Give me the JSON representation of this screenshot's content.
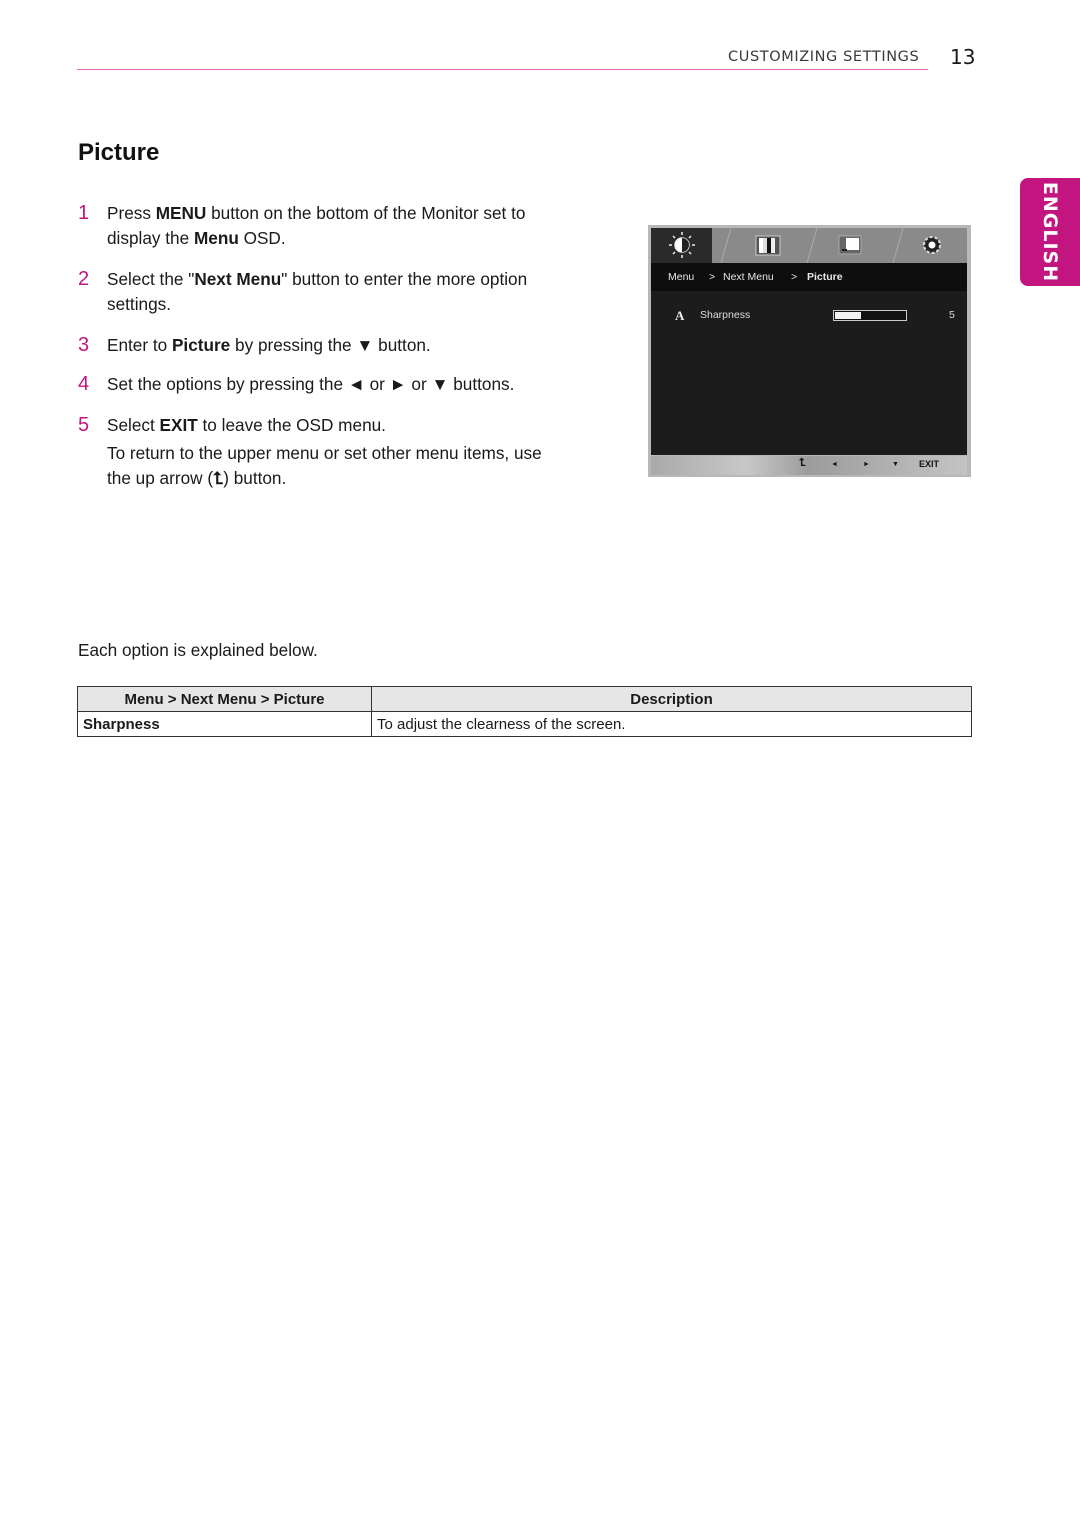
{
  "header": {
    "section": "CUSTOMIZING SETTINGS",
    "page_number": "13",
    "language_tab": "ENGLISH",
    "accent_color": "#c3157f"
  },
  "title": "Picture",
  "steps": [
    {
      "num": "1",
      "parts": [
        "Press ",
        {
          "b": "MENU"
        },
        " button on the bottom of the Monitor set to display the ",
        {
          "b": "Menu"
        },
        " OSD."
      ]
    },
    {
      "num": "2",
      "parts": [
        "Select the \"",
        {
          "b": "Next Menu"
        },
        "\" button to enter the more option settings."
      ]
    },
    {
      "num": "3",
      "parts": [
        "Enter to ",
        {
          "b": "Picture"
        },
        " by pressing the ▼ button."
      ]
    },
    {
      "num": "4",
      "parts": [
        "Set the options by pressing the ◄ or ► or ▼ buttons."
      ]
    },
    {
      "num": "5",
      "parts": [
        "Select ",
        {
          "b": "EXIT"
        },
        " to leave the OSD menu."
      ]
    }
  ],
  "step5_note_before": "To return to the upper menu or set other menu items, use the up arrow (",
  "step5_note_icon": "up-arrow-icon",
  "step5_note_after": ") button.",
  "explain_text": "Each option is explained below.",
  "table": {
    "headers": [
      "Menu > Next Menu > Picture",
      "Description"
    ],
    "rows": [
      [
        "Sharpness",
        "To adjust the clearness of the screen."
      ]
    ]
  },
  "osd": {
    "tab_icons": [
      "brightness-contrast-icon",
      "color-bars-icon",
      "display-position-icon",
      "settings-gear-icon"
    ],
    "breadcrumb": [
      "Menu",
      ">",
      "Next Menu",
      ">",
      "Picture"
    ],
    "item_icon_letter": "A",
    "item_label": "Sharpness",
    "item_value": "5",
    "item_fill_fraction": 0.37,
    "footer_buttons": [
      "⮤",
      "◄",
      "►",
      "▼",
      "EXIT"
    ]
  }
}
